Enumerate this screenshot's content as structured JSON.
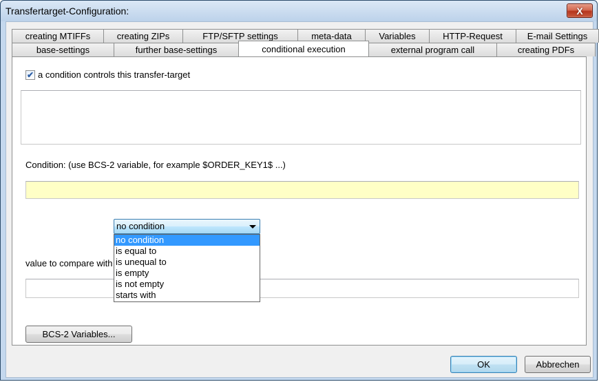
{
  "window": {
    "title": "Transfertarget-Configuration:",
    "close_label": "X"
  },
  "tabs": {
    "row1": [
      {
        "label": "creating MTIFFs"
      },
      {
        "label": "creating ZIPs"
      },
      {
        "label": "FTP/SFTP settings"
      },
      {
        "label": "meta-data"
      },
      {
        "label": "Variables"
      },
      {
        "label": "HTTP-Request"
      },
      {
        "label": "E-mail Settings"
      }
    ],
    "row2": [
      {
        "label": "base-settings"
      },
      {
        "label": "further base-settings"
      },
      {
        "label": "conditional execution",
        "active": true
      },
      {
        "label": "external program call"
      },
      {
        "label": "creating PDFs"
      }
    ]
  },
  "panel": {
    "checkbox_label": "a condition controls this transfer-target",
    "checkbox_checked": true,
    "checkmark": "✔",
    "memo_value": "",
    "condition_label": "Condition: (use BCS-2 variable, for example $ORDER_KEY1$ ...)",
    "condition_value": "",
    "operator_selected": "no condition",
    "operator_options": [
      "no condition",
      "is equal to",
      "is unequal to",
      "is empty",
      "is not empty",
      "starts with"
    ],
    "compare_label": "value to compare with",
    "compare_value": "",
    "variables_button": "BCS-2 Variables..."
  },
  "footer": {
    "ok_label": "OK",
    "cancel_label": "Abbrechen"
  },
  "colors": {
    "condition_field_bg": "#ffffc6",
    "selected_option_bg": "#3399ff"
  }
}
